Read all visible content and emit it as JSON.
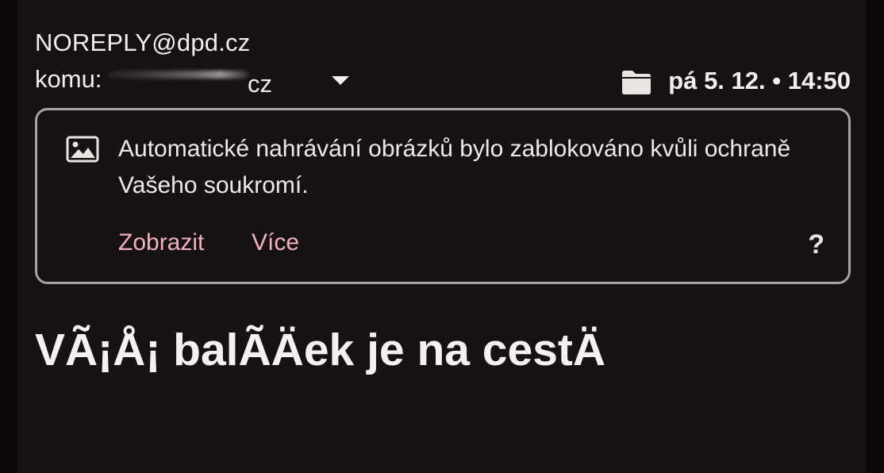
{
  "email": {
    "sender": "NOREPLY@dpd.cz",
    "to_label": "komu:",
    "recipient_visible_suffix": "cz",
    "date_time": "pá 5. 12. • 14:50",
    "subject": "VÃ¡Å¡ balÃÄek je na cestÄ"
  },
  "icons": {
    "folder": "folder-icon",
    "image": "image-icon",
    "dropdown": "chevron-down-icon"
  },
  "notice": {
    "message": "Automatické nahrávání obrázků bylo zablokováno kvůli ochraně Vašeho soukromí.",
    "show_label": "Zobrazit",
    "more_label": "Více",
    "help_label": "?"
  },
  "colors": {
    "background": "#161112",
    "accent_link": "#f3b0be",
    "border": "#a7a2a1"
  }
}
